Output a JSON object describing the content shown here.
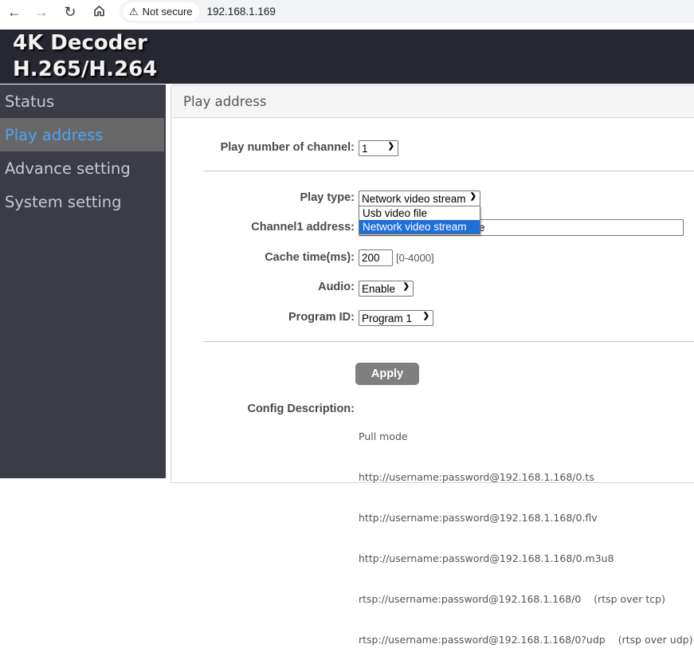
{
  "browser": {
    "back_icon": "arrow-left-icon",
    "forward_icon": "arrow-right-icon",
    "reload_icon": "reload-icon",
    "home_icon": "home-icon",
    "security_label": "Not secure",
    "url": "192.168.1.169"
  },
  "header": {
    "title_line1": "4K Decoder",
    "title_line2": "H.265/H.264"
  },
  "sidebar": {
    "items": [
      {
        "label": "Status",
        "active": false
      },
      {
        "label": "Play address",
        "active": true
      },
      {
        "label": "Advance setting",
        "active": false
      },
      {
        "label": "System setting",
        "active": false
      }
    ]
  },
  "panel": {
    "heading": "Play address",
    "channel_count": {
      "label": "Play number of channel:",
      "value": "1"
    },
    "play_type": {
      "label": "Play type:",
      "value": "Network video stream",
      "options": [
        "Usb video file",
        "Network video stream"
      ],
      "highlighted": "Network video stream"
    },
    "channel_address": {
      "label": "Channel1 address:",
      "visible_value_tail": "e"
    },
    "cache_time": {
      "label": "Cache time(ms):",
      "value": "200",
      "range_hint": "[0-4000]"
    },
    "audio": {
      "label": "Audio:",
      "value": "Enable"
    },
    "program_id": {
      "label": "Program ID:",
      "value": "Program 1"
    },
    "apply_label": "Apply",
    "config": {
      "label": "Config Description:",
      "lines": [
        "Pull mode",
        "http://username:password@192.168.1.168/0.ts",
        "http://username:password@192.168.1.168/0.flv",
        "http://username:password@192.168.1.168/0.m3u8",
        "rtsp://username:password@192.168.1.168/0    (rtsp over tcp)",
        "rtsp://username:password@192.168.1.168/0?udp    (rtsp over udp)"
      ]
    }
  },
  "colors": {
    "header_bg": "#262730",
    "sidebar_bg": "#3b3c48",
    "sidebar_active_bg": "#676767",
    "sidebar_active_text": "#4ea2f2",
    "dropdown_highlight": "#1e6fd9",
    "apply_bg": "#7f7f7f"
  }
}
